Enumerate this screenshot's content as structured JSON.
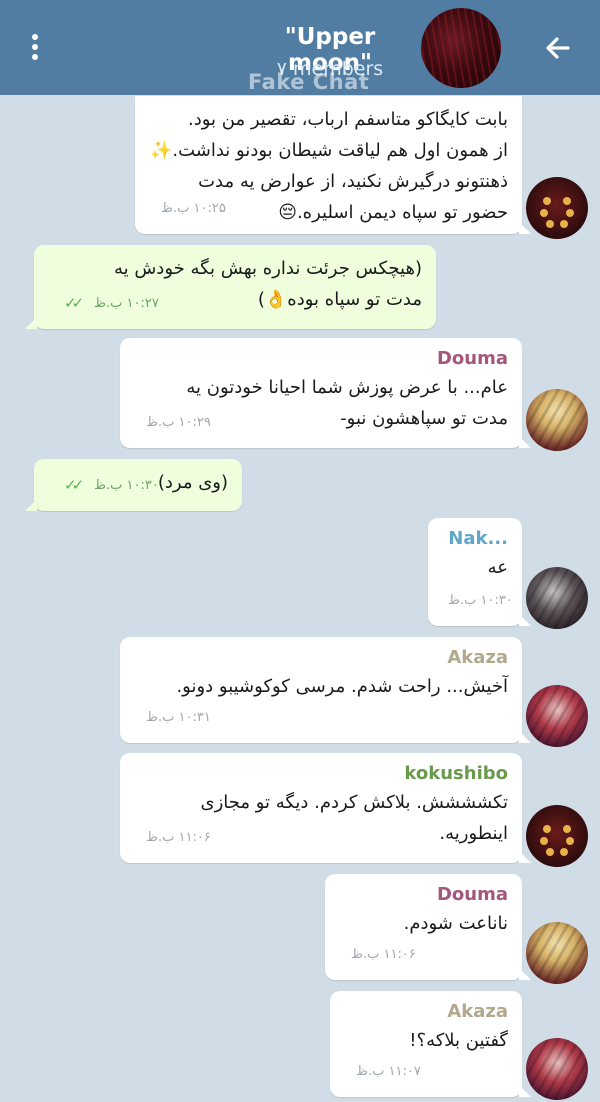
{
  "header": {
    "title": "\"Upper moon\"",
    "members": "۷ members",
    "watermark": "Fake Chat",
    "colors": {
      "bar": "#527da3",
      "background": "#d1dde6",
      "outgoing": "#effedd",
      "incoming": "#ffffff"
    }
  },
  "messages": [
    {
      "sender": "",
      "text": "بابت کایگاکو متاسفم ارباب، تقصیر من بود.\nاز همون اول هم لیاقت شیطان بودنو نداشت.✨\nذهنتونو درگیرش نکنید، از عوارض یه مدت\nحضور تو سپاه دیمن اسلیره.😔",
      "time": "۱۰:۲۵ ب.ظ"
    },
    {
      "sender": "",
      "text": "(هیچکس جرئت نداره بهش بگه خودش یه\nمدت تو سپاه بوده👌)",
      "time": "۱۰:۲۷ ب.ظ",
      "status": "✓✓"
    },
    {
      "sender": "Douma",
      "name_color": "#a3577a",
      "text": "عام... با عرض پوزش شما احیانا خودتون یه\nمدت تو سپاهشون نبو-",
      "time": "۱۰:۲۹ ب.ظ"
    },
    {
      "sender": "",
      "text": "(وی مرد)",
      "time": "۱۰:۳۰ ب.ظ",
      "status": "✓✓"
    },
    {
      "sender": "Nak...",
      "name_color": "#5fa6c8",
      "text": "عه",
      "time": "۱۰:۳۰ ب.ظ"
    },
    {
      "sender": "Akaza",
      "name_color": "#b2a98c",
      "text": "آخیش... راحت شدم. مرسی کوکوشیبو دونو.",
      "time": "۱۰:۳۱ ب.ظ"
    },
    {
      "sender": "kokushibo",
      "name_color": "#6a9b4d",
      "text": "تکشششش. بلاکش کردم. دیگه تو مجازی\nاینطوریه.",
      "time": "۱۱:۰۶ ب.ظ"
    },
    {
      "sender": "Douma",
      "name_color": "#a3577a",
      "text": "ناناعت شودم.",
      "time": "۱۱:۰۶ ب.ظ"
    },
    {
      "sender": "Akaza",
      "name_color": "#b2a98c",
      "text": "گفتین بلاکه؟!",
      "time": "۱۱:۰۷ ب.ظ"
    }
  ]
}
